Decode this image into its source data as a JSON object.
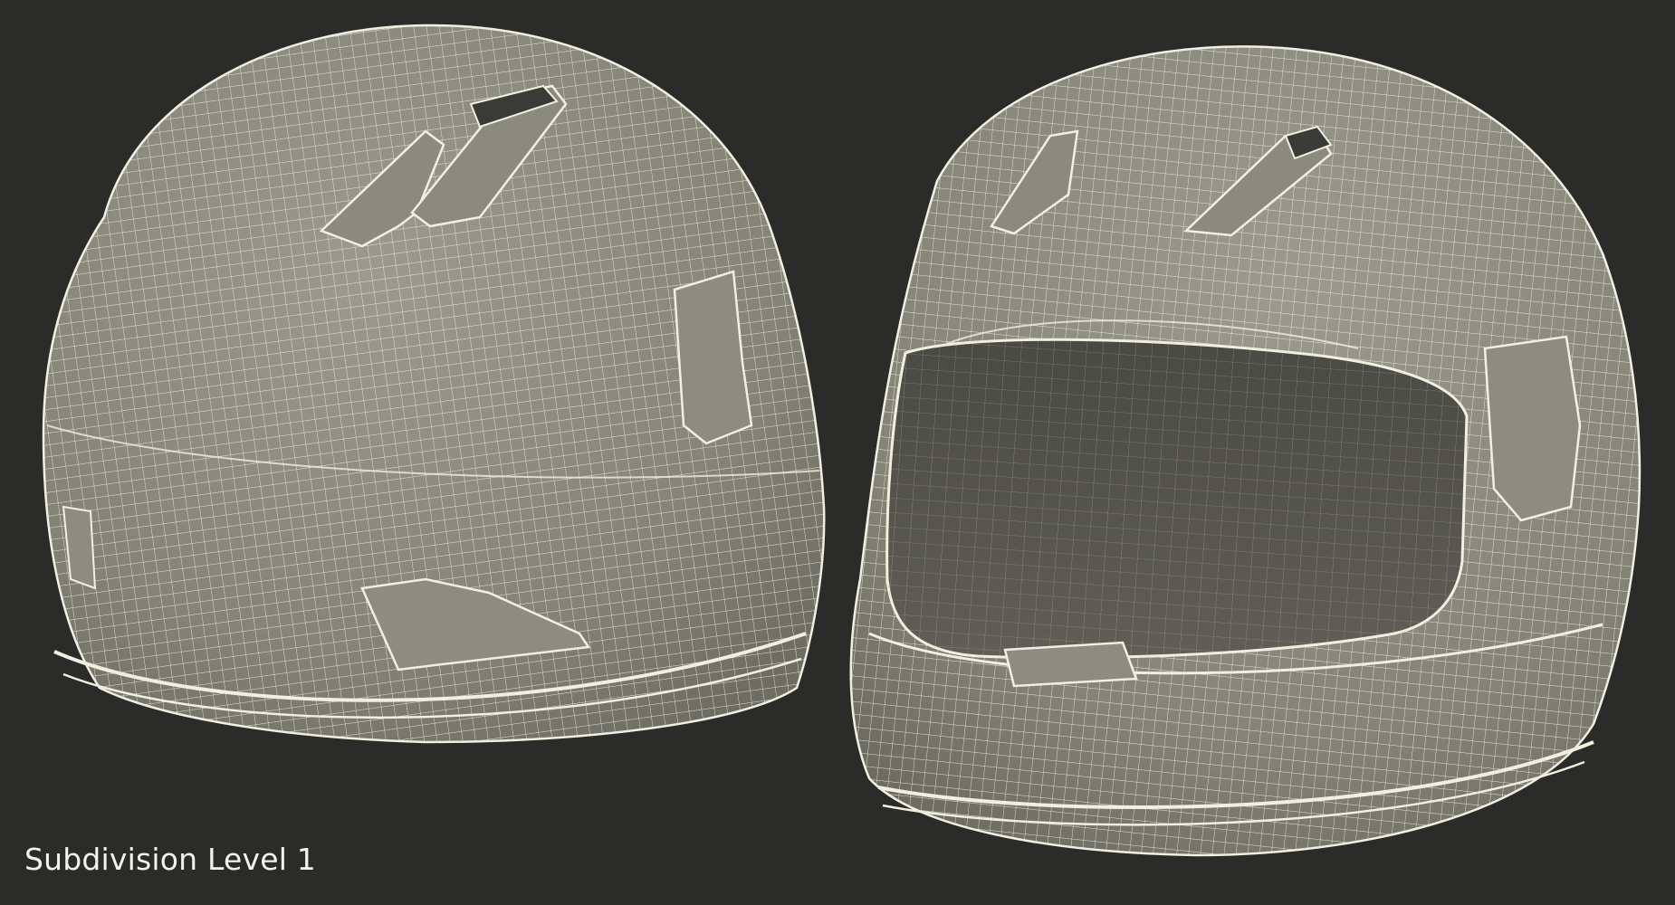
{
  "caption": "Subdivision Level 1",
  "colors": {
    "background": "#2b2b2a",
    "shell": "#8e8e82",
    "wire": "#f1efe0",
    "caption_text": "#f2f2ee"
  },
  "objects": [
    {
      "name": "helmet-rear-view",
      "icon": "helmet-icon"
    },
    {
      "name": "helmet-front-view",
      "icon": "helmet-icon"
    }
  ]
}
